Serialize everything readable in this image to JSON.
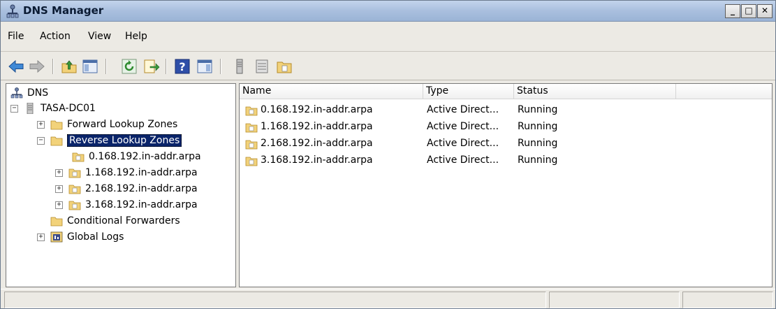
{
  "window": {
    "title": "DNS Manager"
  },
  "window_controls": {
    "minimize": "_",
    "maximize": "□",
    "close": "✕"
  },
  "menu": [
    {
      "label": "File",
      "key": "F"
    },
    {
      "label": "Action",
      "key": "A"
    },
    {
      "label": "View",
      "key": "V"
    },
    {
      "label": "Help",
      "key": "H"
    }
  ],
  "toolbar": {
    "icons": [
      "back-arrow-icon",
      "forward-arrow-icon",
      "up-folder-icon",
      "show-hide-console-tree-icon",
      "refresh-icon",
      "export-list-icon",
      "help-icon",
      "action-pane-icon",
      "server-icon",
      "list-icon",
      "zone-icon"
    ]
  },
  "tree": {
    "root": "DNS",
    "server": "TASA-DC01",
    "forward_zones": "Forward Lookup Zones",
    "reverse_zones": "Reverse Lookup Zones",
    "reverse_children": [
      "0.168.192.in-addr.arpa",
      "1.168.192.in-addr.arpa",
      "2.168.192.in-addr.arpa",
      "3.168.192.in-addr.arpa"
    ],
    "conditional_forwarders": "Conditional Forwarders",
    "global_logs": "Global Logs"
  },
  "list": {
    "columns": [
      "Name",
      "Type",
      "Status"
    ],
    "rows": [
      {
        "name": "0.168.192.in-addr.arpa",
        "type": "Active Direct...",
        "status": "Running"
      },
      {
        "name": "1.168.192.in-addr.arpa",
        "type": "Active Direct...",
        "status": "Running"
      },
      {
        "name": "2.168.192.in-addr.arpa",
        "type": "Active Direct...",
        "status": "Running"
      },
      {
        "name": "3.168.192.in-addr.arpa",
        "type": "Active Direct...",
        "status": "Running"
      }
    ]
  },
  "colors": {
    "selection": "#0a246a",
    "folder": "#f2d27a",
    "titlebar": "#a9bfde"
  }
}
